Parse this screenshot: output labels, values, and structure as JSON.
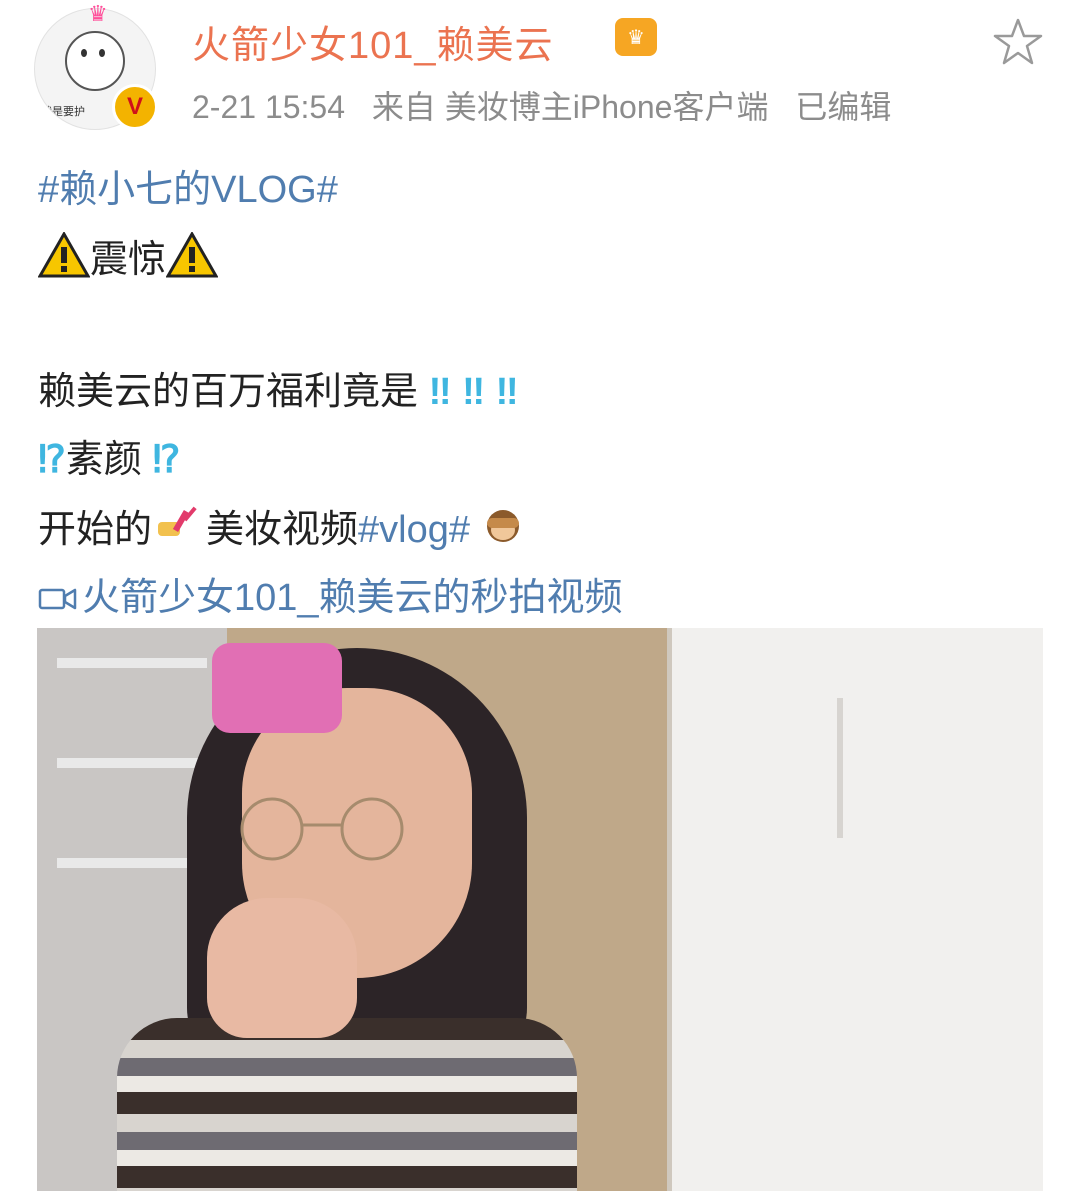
{
  "header": {
    "username": "火箭少女101_赖美云",
    "time": "2-21 15:54",
    "source": "来自 美妆博主iPhone客户端",
    "edited": "已编辑",
    "avatar_caption": "就是要护",
    "verified_badge": "V",
    "star_icon": "star-outline-icon"
  },
  "content": {
    "topic_tag": "#赖小七的VLOG#",
    "shock_text": "震惊",
    "line3_text": "赖美云的百万福利竟是",
    "line3_bangs": [
      "‼",
      "‼",
      "‼"
    ],
    "line4_text": "素颜",
    "line4_marks": [
      "⁉",
      "⁉"
    ],
    "line5_prefix": "开始的",
    "line5_middle": "美妆视频",
    "line5_tag": "#vlog#",
    "video_link": "火箭少女101_赖美云的秒拍视频"
  },
  "colors": {
    "username": "#eb7350",
    "link": "#507daf",
    "meta": "#8c8c8c",
    "emphasis": "#3fb6e0"
  },
  "media": {
    "type": "photo",
    "icon": "video-thumbnail"
  }
}
